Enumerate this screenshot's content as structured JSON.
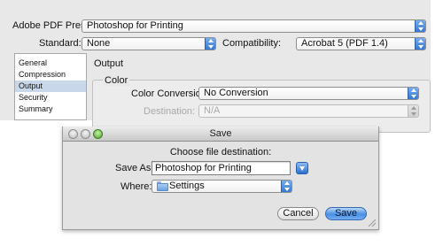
{
  "pdf_dialog": {
    "preset_label": "Adobe PDF Preset:",
    "preset_value": "Photoshop for Printing",
    "standard_label": "Standard:",
    "standard_value": "None",
    "compatibility_label": "Compatibility:",
    "compatibility_value": "Acrobat 5 (PDF 1.4)",
    "sidebar_items": [
      "General",
      "Compression",
      "Output",
      "Security",
      "Summary"
    ],
    "selected_item": "Output",
    "panel_title": "Output",
    "color_group_label": "Color",
    "color_conversion_label": "Color Conversion:",
    "color_conversion_value": "No Conversion",
    "destination_label": "Destination:",
    "destination_value": "N/A"
  },
  "save_dialog": {
    "title": "Save",
    "instruction": "Choose file destination:",
    "save_as_label": "Save As:",
    "save_as_value": "Photoshop for Printing",
    "where_label": "Where:",
    "where_value": "Settings",
    "cancel_label": "Cancel",
    "save_label": "Save"
  }
}
